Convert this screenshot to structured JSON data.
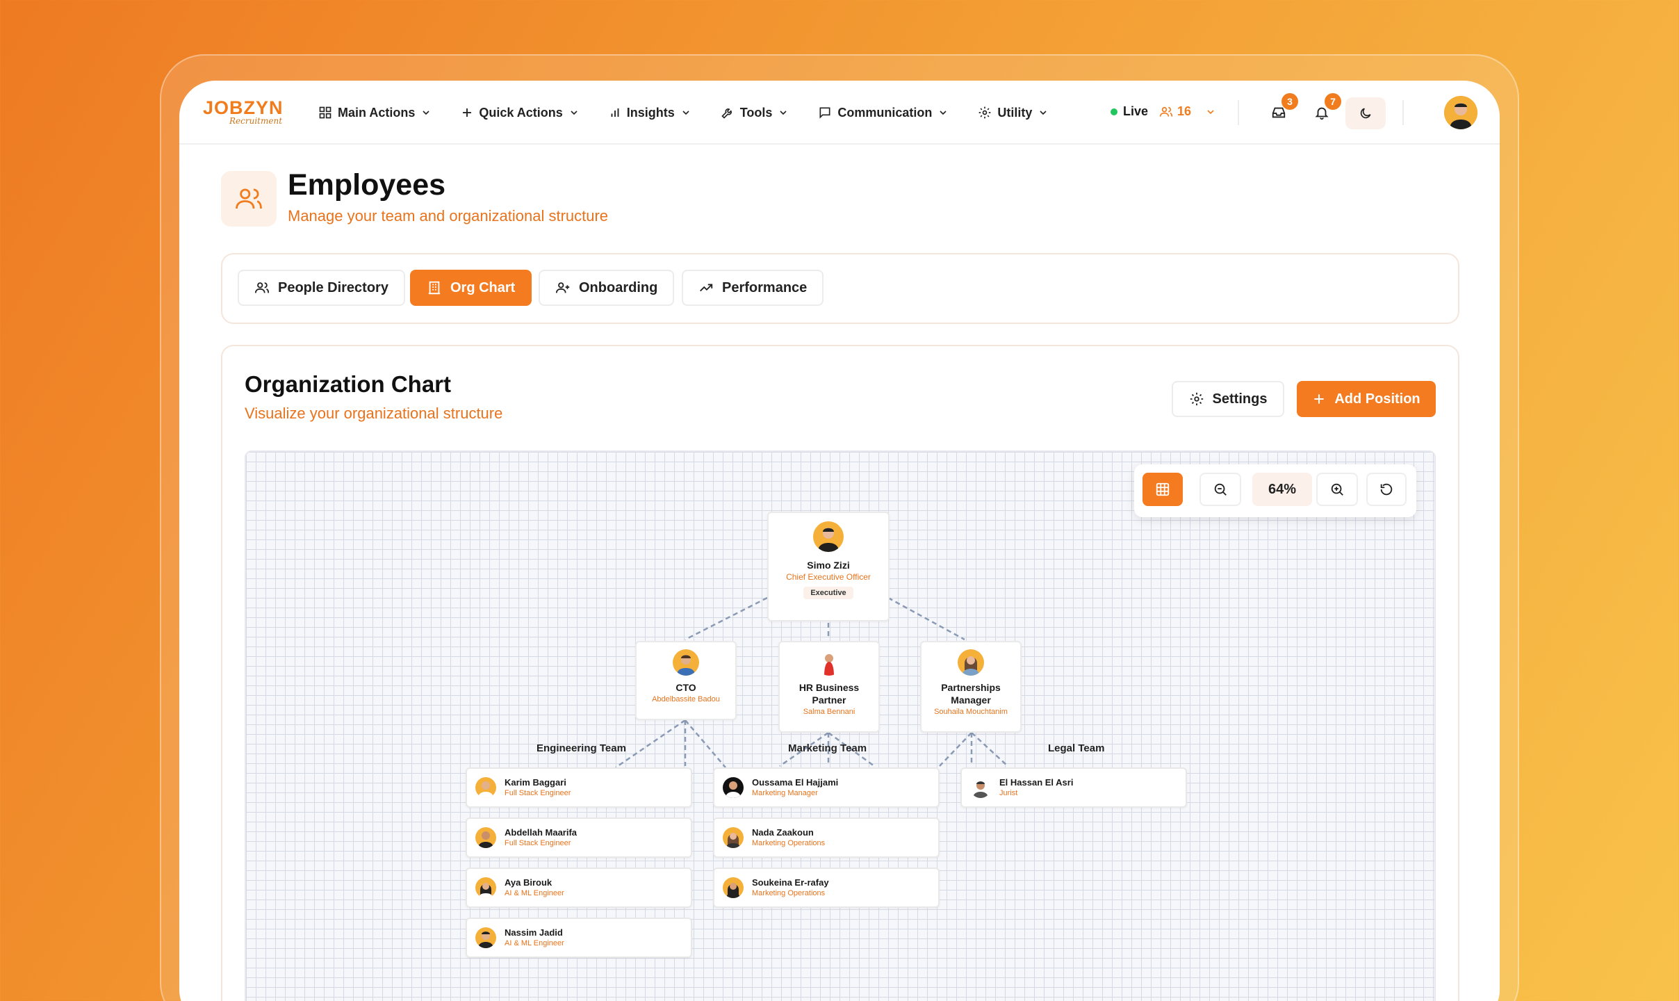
{
  "colors": {
    "accent": "#f47b20",
    "accent_text": "#e8731c",
    "live": "#22c55e"
  },
  "logo": {
    "line1": "JOBZYN",
    "line2": "Recruitment"
  },
  "nav": [
    {
      "label": "Main Actions",
      "icon": "grid-icon"
    },
    {
      "label": "Quick Actions",
      "icon": "plus-icon"
    },
    {
      "label": "Insights",
      "icon": "bar-chart-icon"
    },
    {
      "label": "Tools",
      "icon": "wrench-icon"
    },
    {
      "label": "Communication",
      "icon": "message-icon"
    },
    {
      "label": "Utility",
      "icon": "gear-icon"
    }
  ],
  "status": {
    "live_label": "Live",
    "online_count": "16"
  },
  "inbox_badge": "3",
  "notifications_badge": "7",
  "page": {
    "title": "Employees",
    "subtitle": "Manage your team and organizational structure"
  },
  "tabs": [
    {
      "label": "People Directory",
      "active": false
    },
    {
      "label": "Org Chart",
      "active": true
    },
    {
      "label": "Onboarding",
      "active": false
    },
    {
      "label": "Performance",
      "active": false
    }
  ],
  "org_chart": {
    "title": "Organization Chart",
    "subtitle": "Visualize your organizational structure",
    "settings_label": "Settings",
    "add_label": "Add Position",
    "zoom": "64%",
    "ceo": {
      "name": "Simo Zizi",
      "role": "Chief Executive Officer",
      "tag": "Executive"
    },
    "managers": [
      {
        "title": "CTO",
        "name": "Abdelbassite Badou"
      },
      {
        "title": "HR Business Partner",
        "name": "Salma Bennani"
      },
      {
        "title": "Partnerships Manager",
        "name": "Souhaila Mouchtanim"
      }
    ],
    "teams": [
      {
        "label": "Engineering Team",
        "members": [
          {
            "name": "Karim Baggari",
            "role": "Full Stack Engineer"
          },
          {
            "name": "Abdellah Maarifa",
            "role": "Full Stack Engineer"
          },
          {
            "name": "Aya Birouk",
            "role": "AI & ML Engineer"
          },
          {
            "name": "Nassim Jadid",
            "role": "AI & ML Engineer"
          }
        ]
      },
      {
        "label": "Marketing Team",
        "members": [
          {
            "name": "Oussama El Hajjami",
            "role": "Marketing Manager"
          },
          {
            "name": "Nada Zaakoun",
            "role": "Marketing Operations"
          },
          {
            "name": "Soukeina Er-rafay",
            "role": "Marketing Operations"
          }
        ]
      },
      {
        "label": "Legal Team",
        "members": [
          {
            "name": "El Hassan El Asri",
            "role": "Jurist"
          }
        ]
      }
    ]
  }
}
